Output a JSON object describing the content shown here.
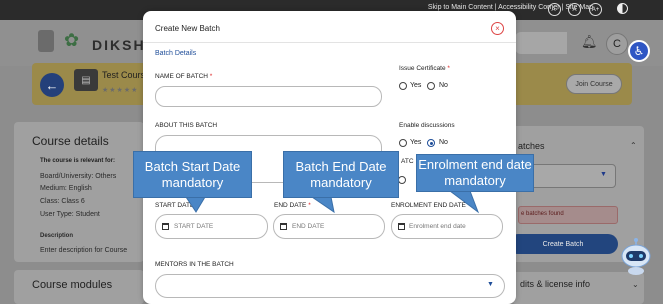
{
  "top_bar": {
    "skip_link": "Skip to Main Content",
    "accessibility_link": "Accessibility Corner",
    "sitemap_link": "Site Map",
    "separator": "|",
    "font_decrease": "A-",
    "font_normal": "A",
    "font_increase": "A+"
  },
  "header": {
    "brand": "DIKSHA",
    "avatar_letter": "C"
  },
  "course_banner": {
    "course_name": "Test Cours",
    "stars": "★★★★★",
    "join_label": "Join Course"
  },
  "course_details": {
    "title": "Course details",
    "relevant_heading": "The course is relevant for:",
    "lines": [
      "Board/University: Others",
      "Medium: English",
      "Class: Class 6",
      "User Type: Student"
    ],
    "description_heading": "Description",
    "description_text": "Enter description for Course"
  },
  "course_modules": {
    "title": "Course modules"
  },
  "batches_panel": {
    "title": "atches",
    "select_value": "g",
    "no_batches": "e batches found",
    "create_label": "Create Batch",
    "credits_title": "dits & license info"
  },
  "modal": {
    "title": "Create New Batch",
    "section_title": "Batch Details",
    "name_label": "NAME OF BATCH",
    "about_label": "ABOUT THIS BATCH",
    "issue_certificate_label": "Issue Certificate",
    "enable_discussions_label": "Enable discussions",
    "yes": "Yes",
    "no": "No",
    "partial_label": "ATC",
    "start_date_label": "START DATE",
    "start_date_placeholder": "START DATE",
    "end_date_label": "END DATE",
    "end_date_placeholder": "END DATE",
    "enrolment_end_label": "ENROLMENT END DATE",
    "enrolment_end_placeholder": "Enrolment end date",
    "mentors_label": "MENTORS IN THE BATCH",
    "required_mark": "*",
    "close_glyph": "×"
  },
  "annotations": {
    "start_date": "Batch Start Date mandatory",
    "end_date": "Batch End Date mandatory",
    "enrolment_end": "Enrolment end date mandatory"
  },
  "colors": {
    "accent": "#1f4e99",
    "required": "#d22222",
    "callout": "#4a86c6"
  },
  "icons": [
    "accessibility-icon",
    "bell-icon",
    "back-arrow-icon",
    "calendar-icon",
    "close-icon",
    "chevron-down-icon",
    "contrast-icon"
  ]
}
